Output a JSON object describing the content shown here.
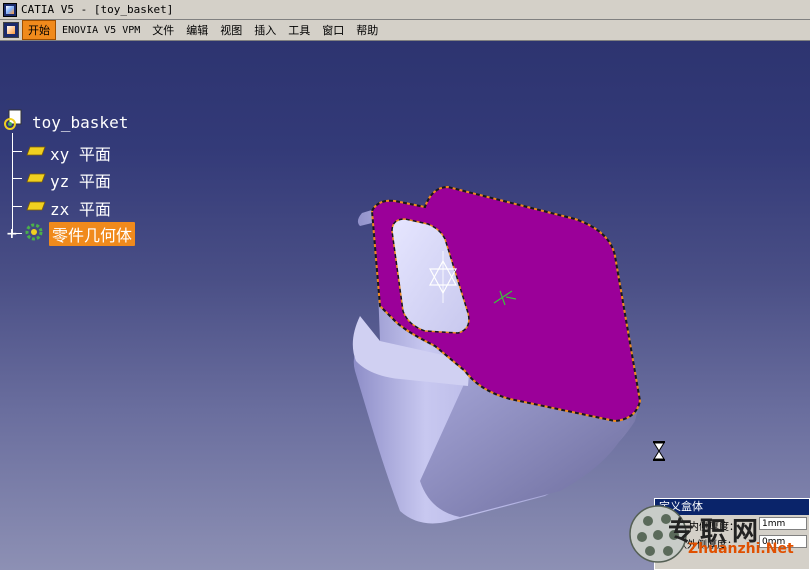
{
  "window": {
    "title": "CATIA V5 - [toy_basket]"
  },
  "menu": {
    "items": [
      "开始",
      "ENOVIA V5 VPM",
      "文件",
      "编辑",
      "视图",
      "插入",
      "工具",
      "窗口",
      "帮助"
    ]
  },
  "tree": {
    "root": "toy_basket",
    "planes": [
      "xy 平面",
      "yz 平面",
      "zx 平面"
    ],
    "body": "零件几何体"
  },
  "dialog": {
    "title": "定义盒体",
    "rows": [
      {
        "label": "内侧厚度：",
        "value": "1mm"
      },
      {
        "label": "默认外侧厚度：",
        "value": "0mm"
      }
    ]
  },
  "watermark": {
    "cn": "专职网",
    "en": "Zhuanzhi.Net"
  },
  "colors": {
    "viewport_top": "#2d3470",
    "viewport_bottom": "#8d90b4",
    "selected_face": "#9b0099",
    "body_surface": "#b8b8e6",
    "menu_active": "#f08a1c"
  }
}
